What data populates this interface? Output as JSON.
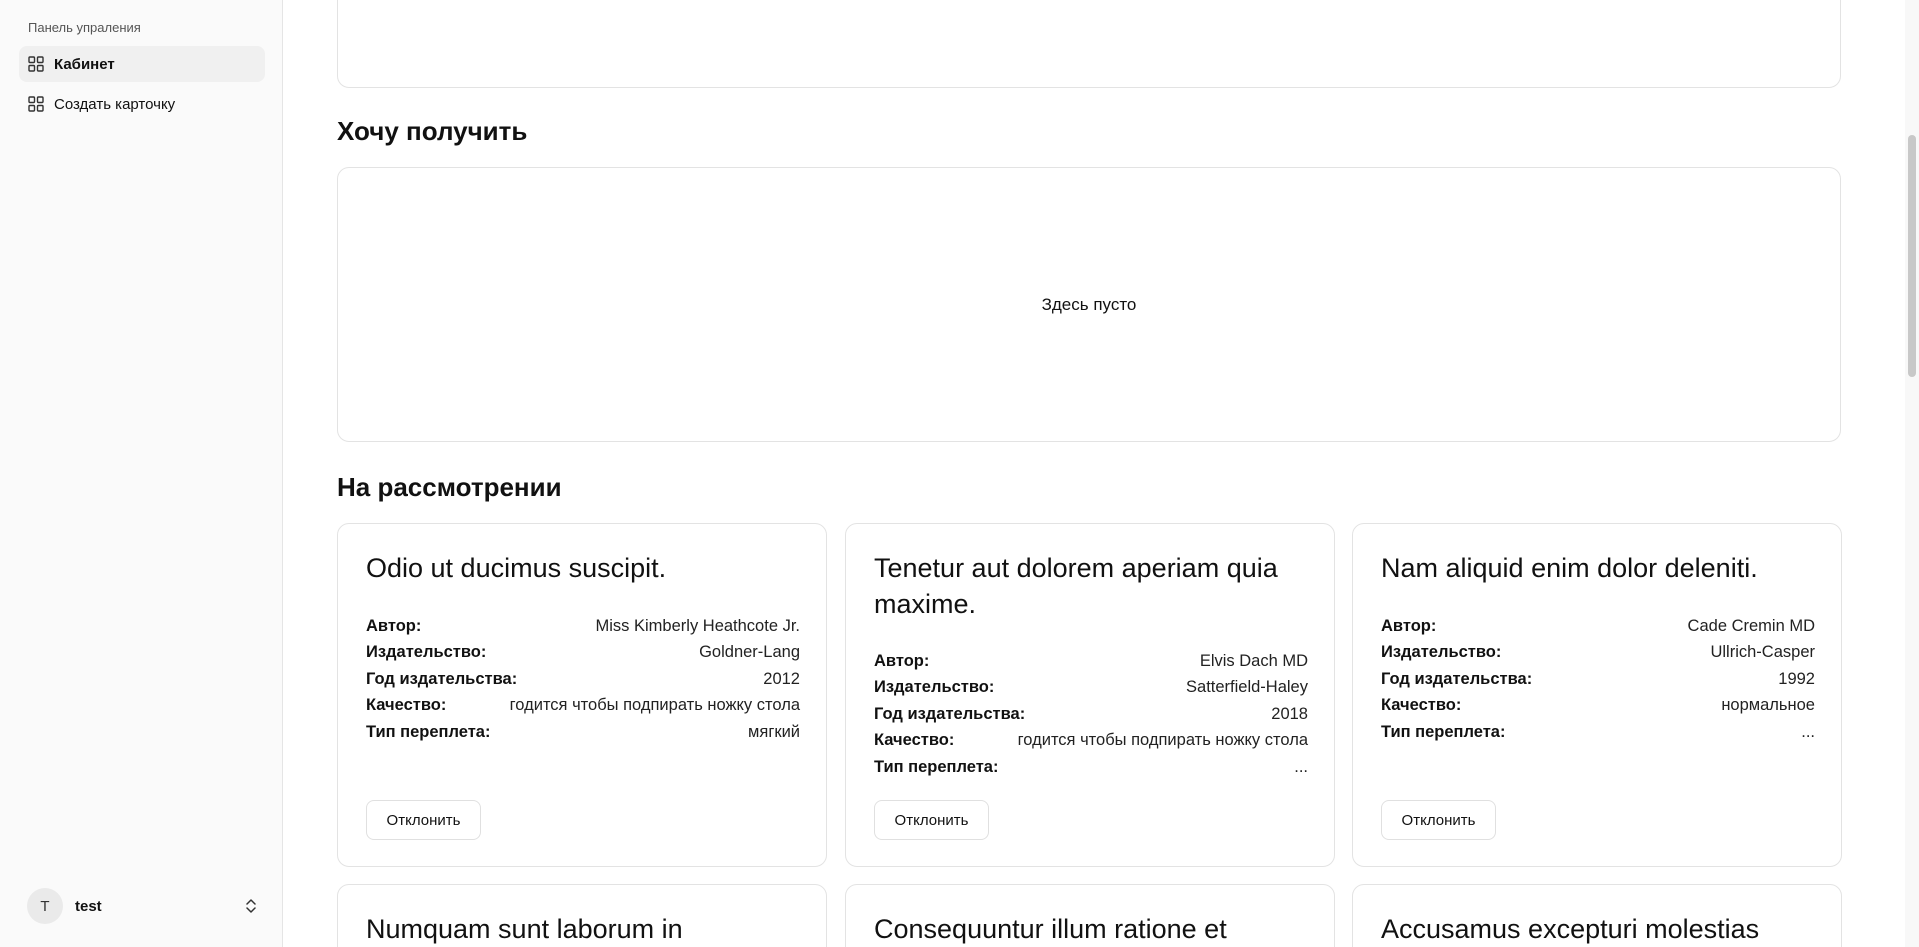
{
  "sidebar": {
    "group_label": "Панель упраления",
    "items": [
      {
        "label": "Кабинет",
        "icon": "grid-icon",
        "active": true
      },
      {
        "label": "Создать карточку",
        "icon": "grid-icon",
        "active": false
      }
    ],
    "user": {
      "initial": "T",
      "name": "test"
    }
  },
  "sections": {
    "want": {
      "title": "Хочу получить",
      "empty_text": "Здесь пусто"
    },
    "review": {
      "title": "На рассмотрении"
    }
  },
  "prop_labels": {
    "author": "Автор:",
    "publisher": "Издательство:",
    "year": "Год издательства:",
    "quality": "Качество:",
    "binding": "Тип переплета:"
  },
  "reject_label": "Отклонить",
  "cards": [
    {
      "title": "Odio ut ducimus suscipit.",
      "author": "Miss Kimberly Heathcote Jr.",
      "publisher": "Goldner-Lang",
      "year": "2012",
      "quality": "годится чтобы подпирать ножку стола",
      "binding": "мягкий"
    },
    {
      "title": "Tenetur aut dolorem aperiam quia maxime.",
      "author": "Elvis Dach MD",
      "publisher": "Satterfield-Haley",
      "year": "2018",
      "quality": "годится чтобы подпирать ножку стола",
      "binding": "..."
    },
    {
      "title": "Nam aliquid enim dolor deleniti.",
      "author": "Cade Cremin MD",
      "publisher": "Ullrich-Casper",
      "year": "1992",
      "quality": "нормальное",
      "binding": "..."
    },
    {
      "title": "Numquam sunt laborum in"
    },
    {
      "title": "Consequuntur illum ratione et"
    },
    {
      "title": "Accusamus excepturi molestias"
    }
  ]
}
